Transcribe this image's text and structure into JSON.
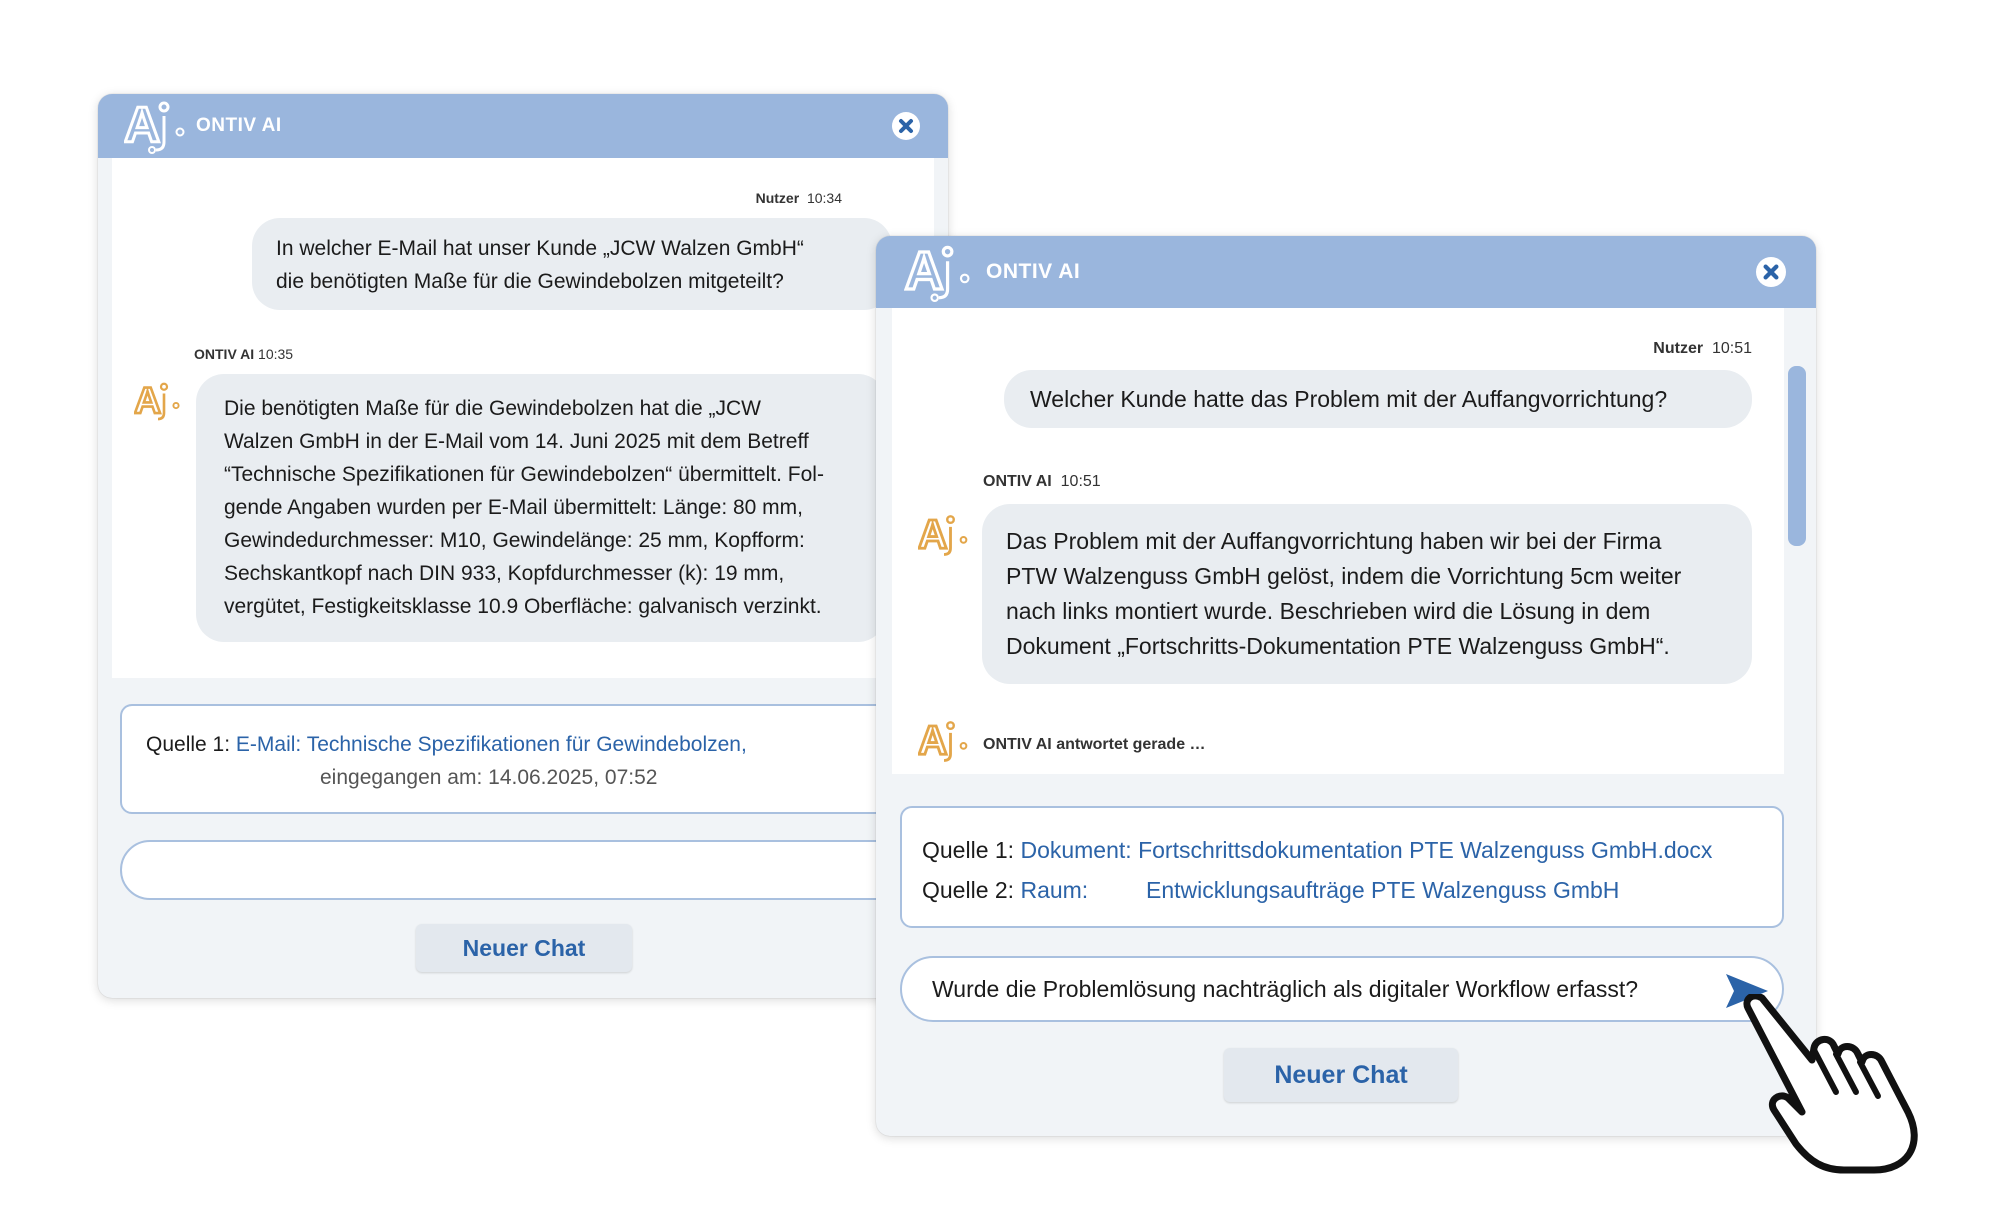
{
  "windows": [
    {
      "title": "ONTIV AI",
      "user_meta": {
        "name": "Nutzer",
        "time": "10:34"
      },
      "user_message": [
        "In welcher E-Mail hat unser Kunde „JCW Walzen GmbH“",
        "die benötigten Maße für die Gewindebolzen mitgeteilt?"
      ],
      "ai_meta": {
        "name": "ONTIV AI",
        "time": "10:35"
      },
      "ai_message": [
        "Die benötigten Maße für die Gewindebolzen hat die „JCW",
        "Walzen GmbH in der E-Mail vom 14. Juni 2025 mit dem Betreff",
        "“Technische Spezifikationen für Gewindebolzen“ übermittelt. Fol-",
        "gende Angaben wurden per E-Mail übermittelt: Länge: 80 mm,",
        "Gewindedurchmesser: M10, Gewindelänge: 25 mm, Kopfform:",
        "Sechskantkopf nach DIN 933, Kopfdurchmesser (k): 19 mm,",
        "vergütet, Festigkeitsklasse 10.9 Oberfläche: galvanisch verzinkt."
      ],
      "sources": [
        {
          "label": "Quelle 1:",
          "link": "E-Mail: Technische Spezifikationen für Gewindebolzen,",
          "detail": "eingegangen am: 14.06.2025, 07:52"
        }
      ],
      "input": {
        "value": ""
      },
      "new_chat_label": "Neuer Chat"
    },
    {
      "title": "ONTIV AI",
      "user_meta": {
        "name": "Nutzer",
        "time": "10:51"
      },
      "user_message": "Welcher Kunde hatte das Problem mit der Auffangvorrichtung?",
      "ai_meta": {
        "name": "ONTIV AI",
        "time": "10:51"
      },
      "ai_message": [
        "Das Problem mit der Auffangvorrichtung haben wir bei der Firma",
        "PTW Walzenguss GmbH gelöst, indem die Vorrichtung 5cm weiter",
        "nach links montiert wurde. Beschrieben wird die Lösung in dem",
        "Dokument „Fortschritts-Dokumentation PTE Walzenguss GmbH“."
      ],
      "typing_status": "ONTIV AI antwortet gerade …",
      "sources": [
        {
          "label": "Quelle 1:",
          "type": "Dokument:",
          "link": "Fortschrittsdokumentation PTE Walzenguss GmbH.docx"
        },
        {
          "label": "Quelle 2:",
          "type": "Raum:",
          "link": "Entwicklungsaufträge PTE Walzenguss GmbH"
        }
      ],
      "input": {
        "value": "Wurde die Problemlösung nachträglich als digitaler Workflow erfasst?"
      },
      "new_chat_label": "Neuer Chat"
    }
  ],
  "colors": {
    "header": "#9ab6dd",
    "accent": "#2b63a8",
    "ai_avatar": "#e3a64a",
    "bubble": "#e9edf1"
  },
  "icons": {
    "logo": "ai-logo-icon",
    "close": "close-icon",
    "avatar": "ai-avatar-icon",
    "send": "send-icon",
    "cursor": "hand-pointer-icon"
  }
}
